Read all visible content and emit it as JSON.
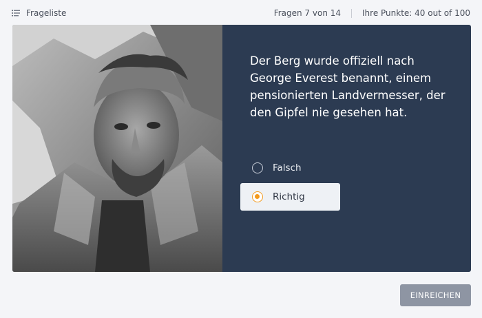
{
  "header": {
    "question_list_label": "Frageliste",
    "question_progress": "Fragen 7 von 14",
    "score": "Ihre Punkte: 40 out of 100"
  },
  "question": {
    "text": "Der Berg wurde offiziell nach George Everest benannt, einem pensionierten Landvermesser, der den Gipfel nie gesehen hat.",
    "options": [
      {
        "label": "Falsch",
        "selected": false
      },
      {
        "label": "Richtig",
        "selected": true
      }
    ]
  },
  "footer": {
    "submit_label": "EINREICHEN"
  },
  "colors": {
    "panel": "#2c3b52",
    "accent": "#f39a1e",
    "submit": "#8e95a3"
  }
}
